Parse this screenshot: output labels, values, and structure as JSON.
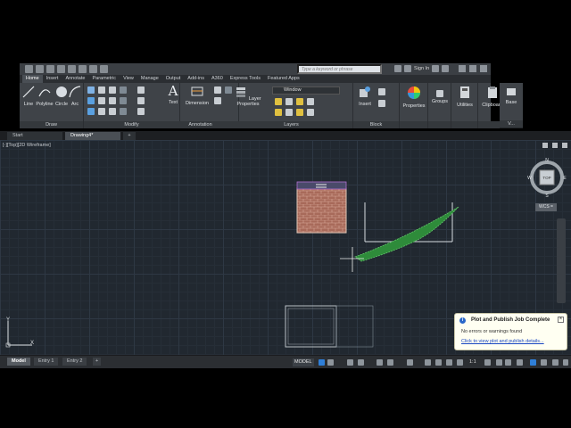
{
  "search": {
    "placeholder": "Type a keyword or phrase"
  },
  "account": {
    "sign_in": "Sign In"
  },
  "ribbon_tabs": [
    "Home",
    "Insert",
    "Annotate",
    "Parametric",
    "View",
    "Manage",
    "Output",
    "Add-ins",
    "A360",
    "Express Tools",
    "Featured Apps"
  ],
  "active_ribbon_tab": "Home",
  "ribbon": {
    "draw": {
      "title": "Draw",
      "tools": [
        "Line",
        "Polyline",
        "Circle",
        "Arc"
      ]
    },
    "modify": {
      "title": "Modify"
    },
    "annotation": {
      "title": "Annotation",
      "text": "Text",
      "dimension": "Dimension"
    },
    "layers": {
      "title": "Layers",
      "layer_properties_1": "Layer",
      "layer_properties_2": "Properties",
      "current_layer": "Window"
    },
    "block": {
      "title": "Block",
      "insert": "Insert"
    },
    "properties": {
      "label": "Properties"
    },
    "groups": {
      "label": "Groups"
    },
    "utilities": {
      "label": "Utilities"
    },
    "clipboard": {
      "label": "Clipboard"
    },
    "base": {
      "label": "Base",
      "view_title": "V..."
    }
  },
  "file_tabs": [
    {
      "label": "Start",
      "active": false
    },
    {
      "label": "Drawing4*",
      "active": true
    }
  ],
  "viewport": {
    "label": "[-][Top][2D Wireframe]",
    "viewcube": {
      "face": "TOP",
      "n": "N",
      "s": "S",
      "e": "E",
      "w": "W"
    },
    "wcs": "WCS ="
  },
  "notification": {
    "title": "Plot and Publish Job Complete",
    "message": "No errors or warnings found",
    "link": "Click to view plot and publish details..."
  },
  "layout_tabs": [
    {
      "label": "Model",
      "active": true
    },
    {
      "label": "Entry 1",
      "active": false
    },
    {
      "label": "Entry 2",
      "active": false
    }
  ],
  "status": {
    "model": "MODEL",
    "scale": "1:1"
  },
  "ucs": {
    "x": "X",
    "y": "Y"
  },
  "colors": {
    "canvas": "#212830",
    "ribbon": "#3f4348",
    "brick": "#a86a5a",
    "hatch": "#2e8b3a"
  }
}
